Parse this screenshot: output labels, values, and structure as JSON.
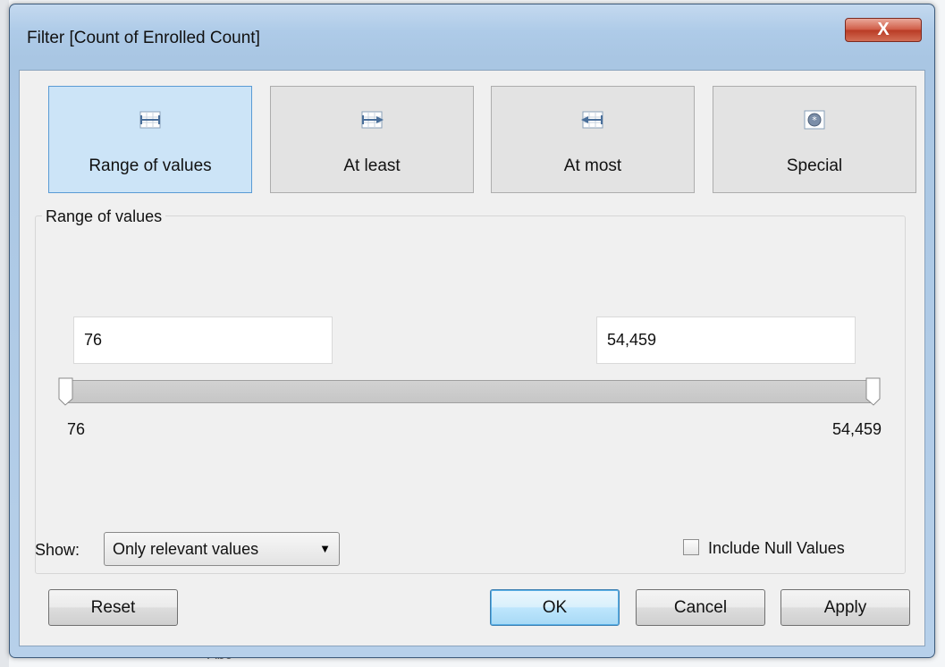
{
  "background": {
    "partial_text": "Abc"
  },
  "window": {
    "title": "Filter [Count of Enrolled Count]",
    "close_glyph": "X"
  },
  "tabs": [
    {
      "label": "Range of values",
      "icon": "range-values-icon",
      "selected": true
    },
    {
      "label": "At least",
      "icon": "at-least-icon",
      "selected": false
    },
    {
      "label": "At most",
      "icon": "at-most-icon",
      "selected": false
    },
    {
      "label": "Special",
      "icon": "special-icon",
      "selected": false
    }
  ],
  "range": {
    "group_title": "Range of values",
    "min_value": "76",
    "max_value": "54,459",
    "axis_min_label": "76",
    "axis_max_label": "54,459"
  },
  "footer": {
    "show_label": "Show:",
    "show_selected": "Only relevant values",
    "include_null_label": "Include Null Values",
    "include_null_checked": false
  },
  "buttons": {
    "reset": "Reset",
    "ok": "OK",
    "cancel": "Cancel",
    "apply": "Apply"
  },
  "colors": {
    "title_bar": "#aecbe8",
    "selected_tab": "#cce4f7",
    "close_button": "#c94a33"
  }
}
